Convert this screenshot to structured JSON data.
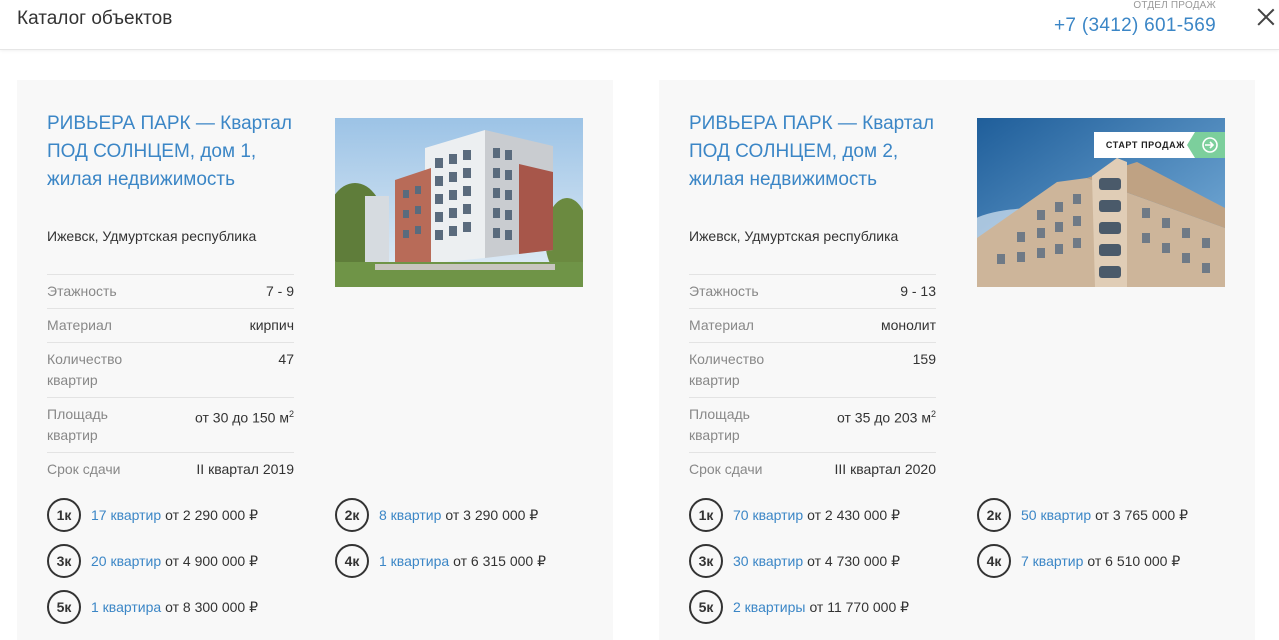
{
  "header": {
    "title": "Каталог объектов",
    "sales_label": "ОТДЕЛ ПРОДАЖ",
    "phone": "+7 (3412) 601-569"
  },
  "colors": {
    "accent": "#3b86c6",
    "badge": "#7ccf9c"
  },
  "objects": [
    {
      "name": "РИВЬЕРА ПАРК — Квартал ПОД СОЛНЦЕМ, дом 1, жилая недвижимость",
      "city": "Ижевск, Удмуртская республика",
      "badge": "",
      "props": [
        {
          "k": "Этажность",
          "v": "7 - 9"
        },
        {
          "k": "Материал",
          "v": "кирпич"
        },
        {
          "k": "Количество квартир",
          "v": "47"
        },
        {
          "k": "Площадь квартир",
          "v": "от 30 до 150 м",
          "sup": "2"
        },
        {
          "k": "Срок сдачи",
          "v": "II квартал 2019"
        }
      ],
      "apartments": [
        {
          "rooms": "1к",
          "count": "17 квартир",
          "price": "от 2 290 000 ₽"
        },
        {
          "rooms": "2к",
          "count": "8 квартир",
          "price": "от 3 290 000 ₽"
        },
        {
          "rooms": "3к",
          "count": "20 квартир",
          "price": "от 4 900 000 ₽"
        },
        {
          "rooms": "4к",
          "count": "1 квартира",
          "price": "от 6 315 000 ₽"
        },
        {
          "rooms": "5к",
          "count": "1 квартира",
          "price": "от 8 300 000 ₽"
        }
      ]
    },
    {
      "name": "РИВЬЕРА ПАРК — Квартал ПОД СОЛНЦЕМ, дом 2, жилая недвижимость",
      "city": "Ижевск, Удмуртская республика",
      "badge": "СТАРТ ПРОДАЖ",
      "props": [
        {
          "k": "Этажность",
          "v": "9 - 13"
        },
        {
          "k": "Материал",
          "v": "монолит"
        },
        {
          "k": "Количество квартир",
          "v": "159"
        },
        {
          "k": "Площадь квартир",
          "v": "от 35 до 203 м",
          "sup": "2"
        },
        {
          "k": "Срок сдачи",
          "v": "III квартал 2020"
        }
      ],
      "apartments": [
        {
          "rooms": "1к",
          "count": "70 квартир",
          "price": "от 2 430 000 ₽"
        },
        {
          "rooms": "2к",
          "count": "50 квартир",
          "price": "от 3 765 000 ₽"
        },
        {
          "rooms": "3к",
          "count": "30 квартир",
          "price": "от 4 730 000 ₽"
        },
        {
          "rooms": "4к",
          "count": "7 квартир",
          "price": "от 6 510 000 ₽"
        },
        {
          "rooms": "5к",
          "count": "2 квартиры",
          "price": "от 11 770 000 ₽"
        }
      ]
    }
  ]
}
